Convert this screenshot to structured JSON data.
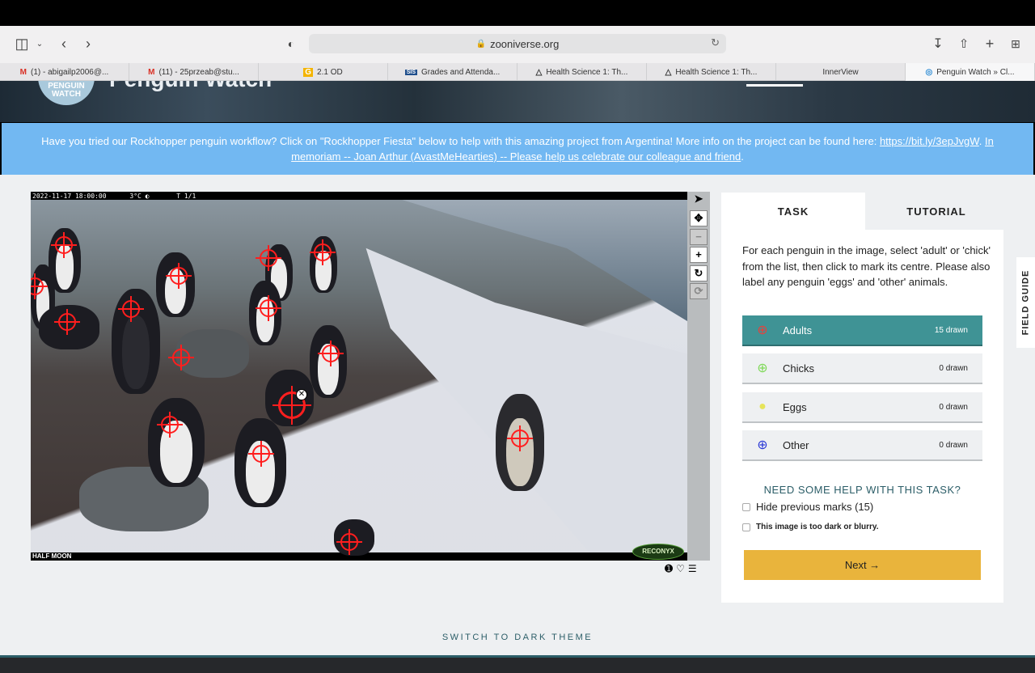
{
  "browser": {
    "url": "zooniverse.org",
    "tabs": [
      {
        "label": "(1) - abigailp2006@...",
        "icon": "M"
      },
      {
        "label": "(11) - 25przeab@stu...",
        "icon": "M"
      },
      {
        "label": "2.1 OD",
        "icon": "G"
      },
      {
        "label": "Grades and Attenda...",
        "icon": "SIS"
      },
      {
        "label": "Health Science 1: Th...",
        "icon": "△"
      },
      {
        "label": "Health Science 1: Th...",
        "icon": "△"
      },
      {
        "label": "InnerView",
        "icon": ""
      },
      {
        "label": "Penguin Watch » Cl...",
        "icon": "◎"
      }
    ]
  },
  "hero": {
    "logo_line1": "PENGUIN",
    "logo_line2": "WATCH",
    "title": "Penguin Watch"
  },
  "banner": {
    "text": "Have you tried our Rockhopper penguin workflow? Click on \"Rockhopper Fiesta\" below to help with this amazing project from Argentina! More info on the project can be found here: ",
    "link1": "https://bit.ly/3epJvgW",
    "sep": ". ",
    "link2": "In memoriam -- Joan Arthur (AvastMeHearties) -- Please help us celebrate our colleague and friend",
    "end": "."
  },
  "subject": {
    "timestamp": "2022-11-17 18:00:00      3°C ◐       T 1/1",
    "site": "HALF MOON",
    "camera_brand": "RECONYX"
  },
  "panel": {
    "tab_task": "TASK",
    "tab_tutorial": "TUTORIAL",
    "instructions": "For each penguin in the image, select 'adult' or 'chick' from the list, then click to mark its centre. Please also label any penguin 'eggs' and 'other' animals.",
    "tools": [
      {
        "name": "Adults",
        "count": "15 drawn",
        "color": "#e8413c"
      },
      {
        "name": "Chicks",
        "count": "0 drawn",
        "color": "#7ed957"
      },
      {
        "name": "Eggs",
        "count": "0 drawn",
        "color": "#e6e45a"
      },
      {
        "name": "Other",
        "count": "0 drawn",
        "color": "#2b39d6"
      }
    ],
    "help": "NEED SOME HELP WITH THIS TASK?",
    "hide_marks": "Hide previous marks (15)",
    "too_dark": "This image is too dark or blurry.",
    "next": "Next →"
  },
  "field_guide": "FIELD GUIDE",
  "theme_toggle": "SWITCH TO DARK THEME",
  "colors": {
    "selected_tool": "#3f9395",
    "next_button": "#e9b43c",
    "banner": "#72b8f2"
  }
}
